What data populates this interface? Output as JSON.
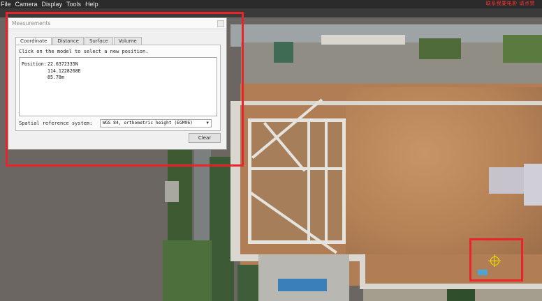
{
  "menu": {
    "items": [
      "File",
      "Camera",
      "Display",
      "Tools",
      "Help"
    ]
  },
  "top_right_note": "联系我要电影 请点赞",
  "dialog": {
    "title": "Measurements",
    "tabs": [
      "Coordinate",
      "Distance",
      "Surface",
      "Volume"
    ],
    "active_tab": "Coordinate",
    "instruction": "Click on the model to select a new position.",
    "position_label": "Position:",
    "position_lat": "22.6372335N",
    "position_lon": "114.1228268E",
    "position_height": "85.78m",
    "srs_label": "Spatial reference system:",
    "srs_value": "WGS 84, orthometric height (EGM96)",
    "clear_label": "Clear"
  },
  "colors": {
    "annotation_red": "#e8242a",
    "crosshair_yellow": "#f3e600",
    "menubar_bg": "#2b2b2b"
  },
  "icons": {
    "dropdown": "chevron-down-icon",
    "target": "crosshair-icon"
  }
}
